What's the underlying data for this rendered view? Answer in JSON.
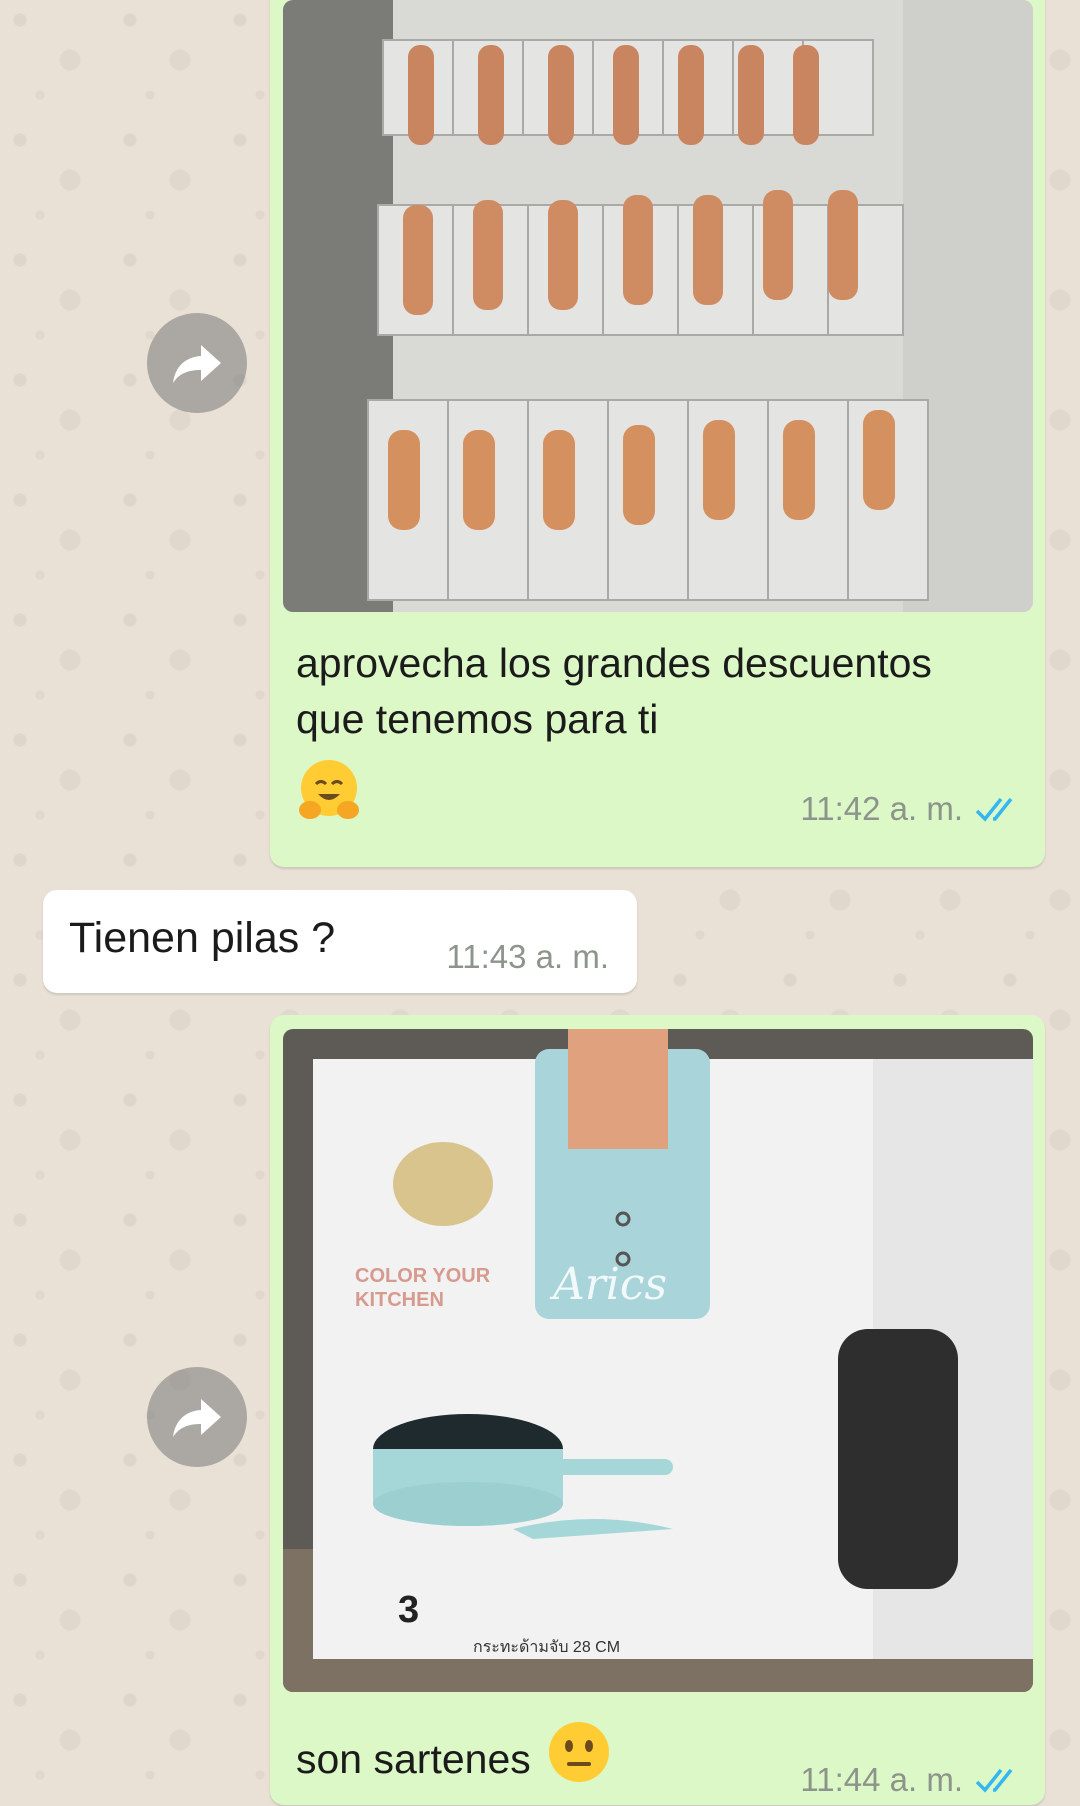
{
  "messages": [
    {
      "direction": "outgoing",
      "media": "photo",
      "caption": "aprovecha los grandes descuentos que tenemos para ti",
      "emoji": "hugging-face",
      "time": "11:42 a. m.",
      "status": "read"
    },
    {
      "direction": "incoming",
      "text": "Tienen pilas ?",
      "time": "11:43 a. m."
    },
    {
      "direction": "outgoing",
      "media": "photo",
      "caption": "son sartenes",
      "emoji": "neutral-face",
      "time": "11:44 a. m.",
      "status": "read",
      "photo_text": {
        "box_slogan": "COLOR YOUR KITCHEN",
        "brand": "Arics",
        "count": "3",
        "footer": "กระทะด้ามจับ 28 CM"
      }
    }
  ],
  "colors": {
    "outgoing_bubble": "#dcf8c6",
    "incoming_bubble": "#ffffff",
    "read_ticks": "#34b7f1"
  },
  "icons": {
    "forward": "forward-arrow-icon",
    "read_status": "double-check-icon"
  }
}
